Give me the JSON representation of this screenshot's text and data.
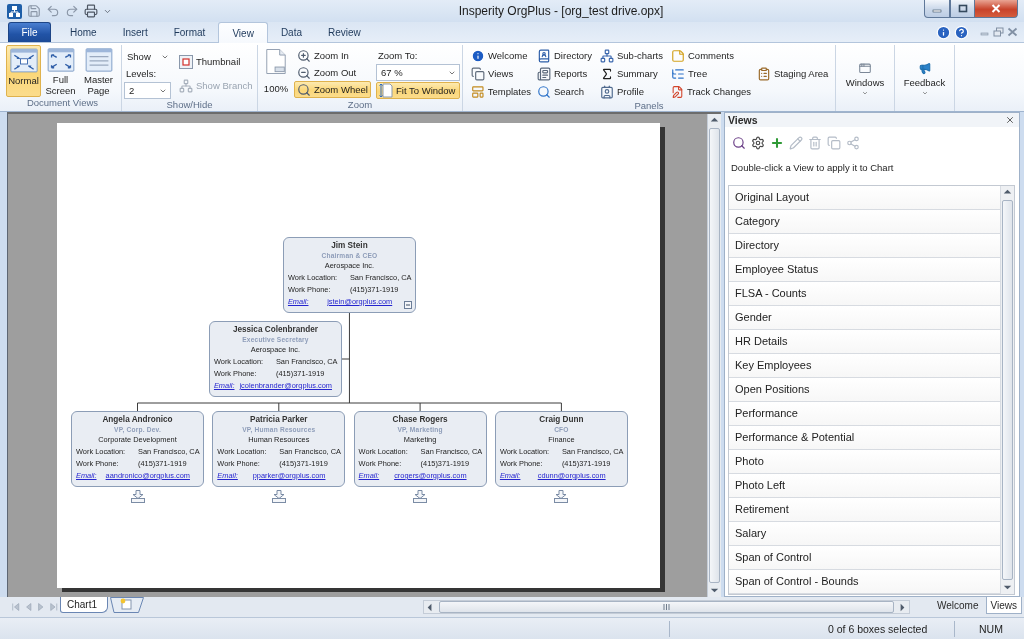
{
  "title_bar": {
    "title": "Insperity OrgPlus - [org_test drive.opx]"
  },
  "ribbon_tabs": [
    {
      "label": "File",
      "kind": "file",
      "selected": false
    },
    {
      "label": "Home",
      "kind": "tab",
      "selected": false
    },
    {
      "label": "Insert",
      "kind": "tab",
      "selected": false
    },
    {
      "label": "Format",
      "kind": "tab",
      "selected": false
    },
    {
      "label": "View",
      "kind": "tab",
      "selected": true
    },
    {
      "label": "Data",
      "kind": "tab",
      "selected": false
    },
    {
      "label": "Review",
      "kind": "tab",
      "selected": false
    }
  ],
  "ribbon": {
    "document_views": {
      "label": "Document Views",
      "buttons": [
        {
          "label": "Normal",
          "selected": true
        },
        {
          "label": "Full Screen",
          "selected": false
        },
        {
          "label": "Master Page",
          "selected": false
        }
      ]
    },
    "show_hide": {
      "label": "Show/Hide",
      "show": "Show",
      "levels_label": "Levels:",
      "levels_value": "2",
      "thumbnail": "Thumbnail",
      "show_branch": {
        "label": "Show Branch",
        "disabled": true
      }
    },
    "zoom": {
      "label": "Zoom",
      "full_size": "100%",
      "zoom_in": "Zoom In",
      "zoom_out": "Zoom Out",
      "zoom_wheel": {
        "label": "Zoom Wheel",
        "selected": true
      },
      "zoom_to_label": "Zoom To:",
      "zoom_to_value": "67 %",
      "fit_to_window": {
        "label": "Fit To Window",
        "selected": true
      }
    },
    "panels": {
      "label": "Panels",
      "items": [
        {
          "label": "Welcome"
        },
        {
          "label": "Views"
        },
        {
          "label": "Templates"
        },
        {
          "label": "Directory"
        },
        {
          "label": "Reports"
        },
        {
          "label": "Search"
        },
        {
          "label": "Sub-charts"
        },
        {
          "label": "Summary"
        },
        {
          "label": "Profile"
        },
        {
          "label": "Comments"
        },
        {
          "label": "Tree"
        },
        {
          "label": "Track Changes"
        },
        {
          "label": "Staging Area"
        }
      ]
    },
    "windows": {
      "label": "Windows"
    },
    "feedback": {
      "label": "Feedback"
    }
  },
  "org_chart": {
    "root": {
      "name": "Jim Stein",
      "title": "Chairman & CEO",
      "department": "Aerospace Inc.",
      "fields": [
        {
          "kind": "text",
          "label": "Work Location:",
          "value": "San Francisco, CA"
        },
        {
          "kind": "text",
          "label": "Work Phone:",
          "value": "(415)371-1919"
        },
        {
          "kind": "link",
          "label": "Email:",
          "value": "jstein@orgplus.com"
        }
      ],
      "expanded": true,
      "assistants": [
        {
          "name": "Jessica Colenbrander",
          "title": "Executive Secretary",
          "department": "Aerospace Inc.",
          "fields": [
            {
              "kind": "text",
              "label": "Work Location:",
              "value": "San Francisco, CA"
            },
            {
              "kind": "text",
              "label": "Work Phone:",
              "value": "(415)371-1919"
            },
            {
              "kind": "link",
              "label": "Email:",
              "value": "jcolenbrander@orgplus.com"
            }
          ]
        }
      ],
      "children": [
        {
          "name": "Angela Andronico",
          "title": "VP, Corp. Dev.",
          "department": "Corporate Development",
          "fields": [
            {
              "kind": "text",
              "label": "Work Location:",
              "value": "San Francisco, CA"
            },
            {
              "kind": "text",
              "label": "Work Phone:",
              "value": "(415)371-1919"
            },
            {
              "kind": "link",
              "label": "Email:",
              "value": "aandronico@orgplus.com"
            }
          ],
          "expanded": false
        },
        {
          "name": "Patricia Parker",
          "title": "VP, Human Resources",
          "department": "Human Resources",
          "fields": [
            {
              "kind": "text",
              "label": "Work Location:",
              "value": "San Francisco, CA"
            },
            {
              "kind": "text",
              "label": "Work Phone:",
              "value": "(415)371-1919"
            },
            {
              "kind": "link",
              "label": "Email:",
              "value": "pparker@orgplus.com"
            }
          ],
          "expanded": false
        },
        {
          "name": "Chase Rogers",
          "title": "VP, Marketing",
          "department": "Marketing",
          "fields": [
            {
              "kind": "text",
              "label": "Work Location:",
              "value": "San Francisco, CA"
            },
            {
              "kind": "text",
              "label": "Work Phone:",
              "value": "(415)371-1919"
            },
            {
              "kind": "link",
              "label": "Email:",
              "value": "crogers@orgplus.com"
            }
          ],
          "expanded": false
        },
        {
          "name": "Craig Dunn",
          "title": "CFO",
          "department": "Finance",
          "fields": [
            {
              "kind": "text",
              "label": "Work Location:",
              "value": "San Francisco, CA"
            },
            {
              "kind": "text",
              "label": "Work Phone:",
              "value": "(415)371-1919"
            },
            {
              "kind": "link",
              "label": "Email:",
              "value": "cdunn@orgplus.com"
            }
          ],
          "expanded": false
        }
      ]
    }
  },
  "views_panel": {
    "title": "Views",
    "toolbar": [
      {
        "disabled": false
      },
      {
        "disabled": false
      },
      {
        "disabled": false
      },
      {
        "disabled": true
      },
      {
        "disabled": true
      },
      {
        "disabled": true
      },
      {
        "disabled": true
      }
    ],
    "hint": "Double-click a View to apply it to Chart",
    "items": [
      {
        "label": "Original Layout",
        "selected": false
      },
      {
        "label": "Category",
        "selected": false
      },
      {
        "label": "Directory",
        "selected": false
      },
      {
        "label": "Employee Status",
        "selected": false
      },
      {
        "label": "FLSA - Counts",
        "selected": false
      },
      {
        "label": "Gender",
        "selected": false
      },
      {
        "label": "HR Details",
        "selected": false
      },
      {
        "label": "Key Employees",
        "selected": false
      },
      {
        "label": "Open Positions",
        "selected": false
      },
      {
        "label": "Performance",
        "selected": false
      },
      {
        "label": "Performance & Potential",
        "selected": false
      },
      {
        "label": "Photo",
        "selected": false
      },
      {
        "label": "Photo Left",
        "selected": false
      },
      {
        "label": "Retirement",
        "selected": false
      },
      {
        "label": "Salary",
        "selected": false
      },
      {
        "label": "Span of Control",
        "selected": false
      },
      {
        "label": "Span of Control - Bounds",
        "selected": false
      }
    ]
  },
  "sheet_tabs": [
    {
      "label": "Chart1",
      "selected": true
    }
  ],
  "panel_tabs": [
    {
      "label": "Welcome",
      "selected": false
    },
    {
      "label": "Views",
      "selected": true
    }
  ],
  "status_bar": {
    "selection": "0 of 6 boxes selected",
    "num_lock": "NUM"
  }
}
